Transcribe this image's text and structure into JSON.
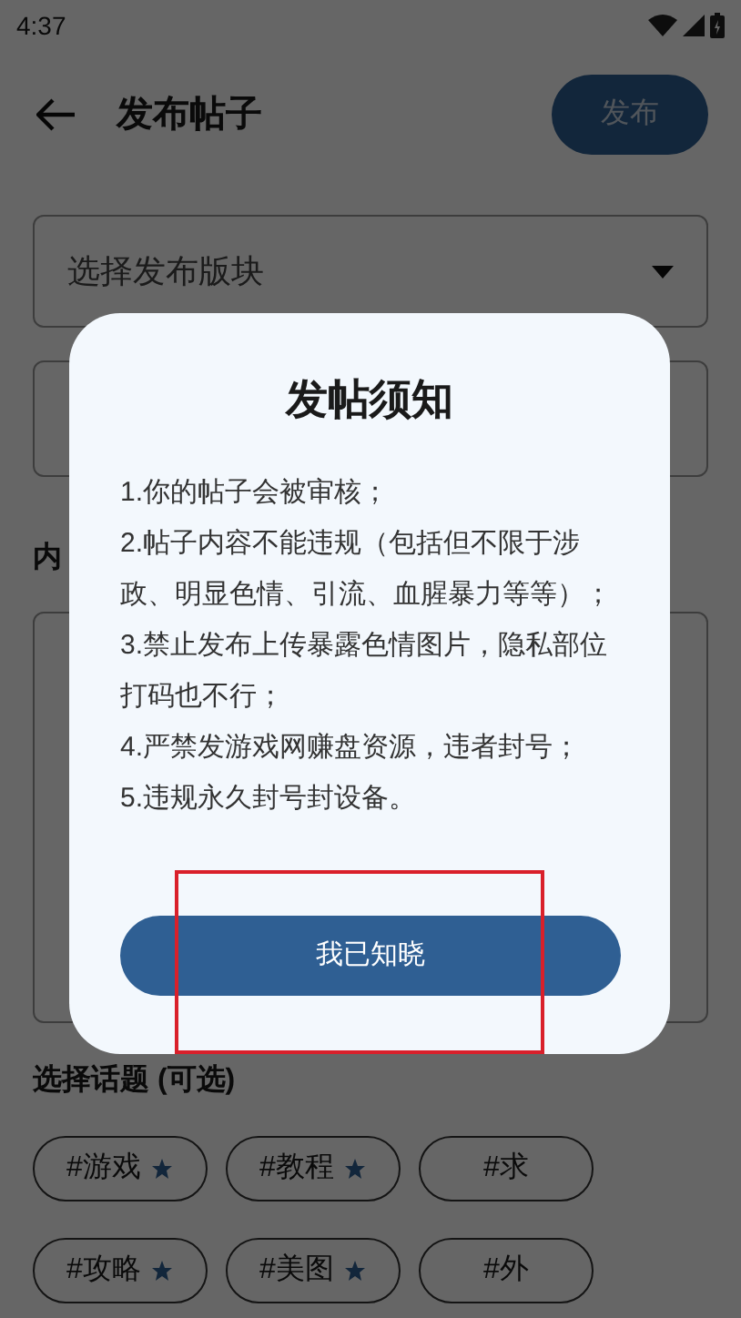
{
  "status_bar": {
    "time": "4:37"
  },
  "header": {
    "title": "发布帖子",
    "publish_button": "发布"
  },
  "form": {
    "section_select": {
      "placeholder": "选择发布版块"
    },
    "content_label": "内",
    "topics_label": "选择话题 (可选)",
    "topics": [
      {
        "label": "#游戏",
        "starred": true
      },
      {
        "label": "#教程",
        "starred": true
      },
      {
        "label": "#求",
        "starred": false
      },
      {
        "label": "#攻略",
        "starred": true
      },
      {
        "label": "#美图",
        "starred": true
      },
      {
        "label": "#外",
        "starred": false
      }
    ]
  },
  "dialog": {
    "title": "发帖须知",
    "lines": [
      "1.你的帖子会被审核；",
      "2.帖子内容不能违规（包括但不限于涉政、明显色情、引流、血腥暴力等等）；",
      "3.禁止发布上传暴露色情图片，隐私部位打码也不行；",
      "4.严禁发游戏网赚盘资源，违者封号；",
      "5.违规永久封号封设备。"
    ],
    "confirm_button": "我已知晓",
    "highlighted": true
  }
}
